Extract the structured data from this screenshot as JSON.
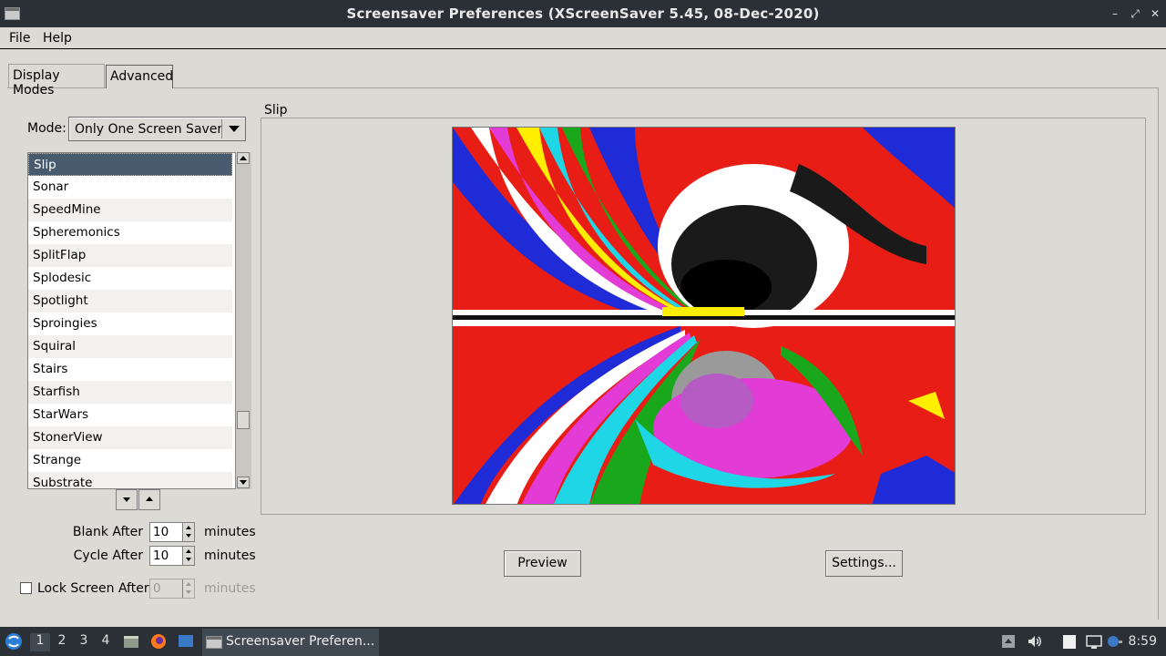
{
  "window": {
    "title": "Screensaver Preferences  (XScreenSaver 5.45, 08-Dec-2020)",
    "minimize": "–",
    "maximize": "⤢",
    "close": "✕"
  },
  "menubar": {
    "file": "File",
    "help": "Help"
  },
  "tabs": {
    "display_modes": "Display Modes",
    "advanced": "Advanced"
  },
  "mode": {
    "label": "Mode:",
    "selected": "Only One Screen Saver"
  },
  "screensavers": [
    "Slip",
    "Sonar",
    "SpeedMine",
    "Spheremonics",
    "SplitFlap",
    "Splodesic",
    "Spotlight",
    "Sproingies",
    "Squiral",
    "Stairs",
    "Starfish",
    "StarWars",
    "StonerView",
    "Strange",
    "Substrate"
  ],
  "selected_screensaver": "Slip",
  "timing": {
    "blank_after_label": "Blank After",
    "blank_after_value": "10",
    "cycle_after_label": "Cycle After",
    "cycle_after_value": "10",
    "lock_label": "Lock Screen After",
    "lock_value": "0",
    "lock_checked": false,
    "unit": "minutes"
  },
  "preview_frame": {
    "label": "Slip",
    "preview_button": "Preview",
    "settings_button": "Settings..."
  },
  "taskbar": {
    "workspaces": [
      "1",
      "2",
      "3",
      "4"
    ],
    "active_workspace": "1",
    "task_label": "Screensaver Preferen...",
    "clock": "8:59"
  },
  "colors": {
    "accent_selection": "#485a6e",
    "titlebar": "#2b3036",
    "window_bg": "#dcdad5"
  }
}
